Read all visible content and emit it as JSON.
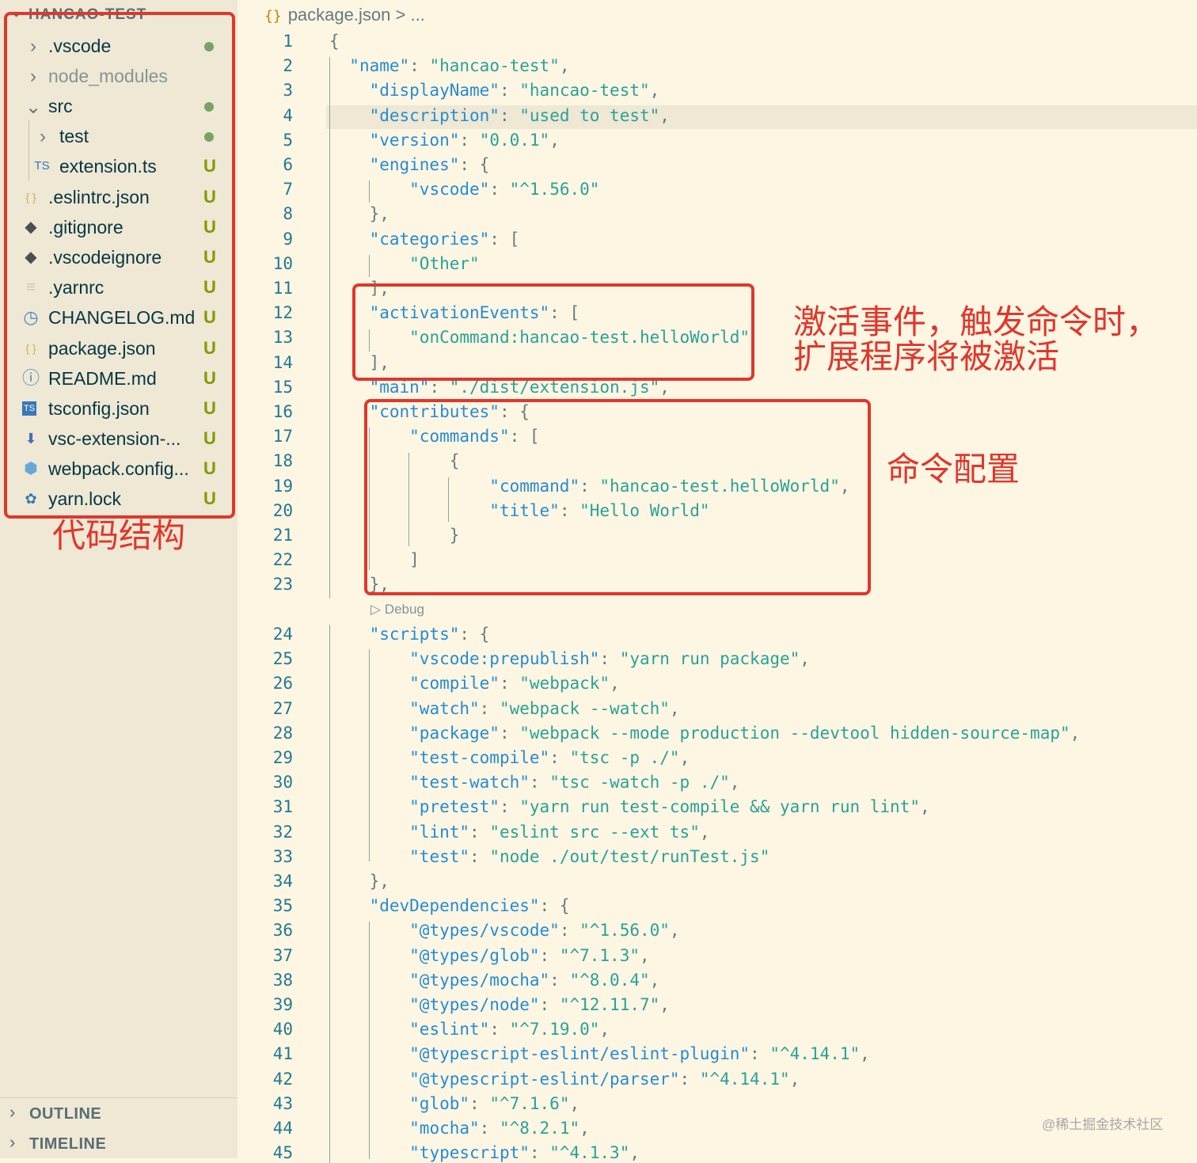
{
  "explorer": {
    "title": "HANCAO-TEST",
    "items": [
      {
        "label": ".vscode",
        "icon": "chevron-right",
        "status": "dot"
      },
      {
        "label": "node_modules",
        "icon": "chevron-right",
        "status": ""
      },
      {
        "label": "src",
        "icon": "chevron-down",
        "status": "dot"
      },
      {
        "label": "test",
        "icon": "chevron-right",
        "status": "dot"
      },
      {
        "label": "extension.ts",
        "icon": "ts-file-icon",
        "icon_text": "TS",
        "status": "U"
      },
      {
        "label": ".eslintrc.json",
        "icon": "json-file-icon",
        "icon_text": "{}",
        "status": "U"
      },
      {
        "label": ".gitignore",
        "icon": "git-file-icon",
        "status": "U"
      },
      {
        "label": ".vscodeignore",
        "icon": "git-file-icon",
        "status": "U"
      },
      {
        "label": ".yarnrc",
        "icon": "text-file-icon",
        "status": "U"
      },
      {
        "label": "CHANGELOG.md",
        "icon": "clock-file-icon",
        "status": "U"
      },
      {
        "label": "package.json",
        "icon": "json-file-icon",
        "icon_text": "{}",
        "status": "U"
      },
      {
        "label": "README.md",
        "icon": "info-file-icon",
        "status": "U"
      },
      {
        "label": "tsconfig.json",
        "icon": "tsconfig-file-icon",
        "icon_text": "TS",
        "status": "U"
      },
      {
        "label": "vsc-extension-...",
        "icon": "download-file-icon",
        "status": "U"
      },
      {
        "label": "webpack.config...",
        "icon": "webpack-file-icon",
        "status": "U"
      },
      {
        "label": "yarn.lock",
        "icon": "yarn-file-icon",
        "status": "U"
      }
    ]
  },
  "panels": {
    "outline": "OUTLINE",
    "timeline": "TIMELINE"
  },
  "breadcrumb": {
    "file": "package.json",
    "separator": ">",
    "more": "..."
  },
  "codelens": "Debug",
  "code_lines": [
    "{",
    "  \"name\": \"hancao-test\",",
    "    \"displayName\": \"hancao-test\",",
    "    \"description\": \"used to test\",",
    "    \"version\": \"0.0.1\",",
    "    \"engines\": {",
    "        \"vscode\": \"^1.56.0\"",
    "    },",
    "    \"categories\": [",
    "        \"Other\"",
    "    ],",
    "    \"activationEvents\": [",
    "        \"onCommand:hancao-test.helloWorld\"",
    "    ],",
    "    \"main\": \"./dist/extension.js\",",
    "    \"contributes\": {",
    "        \"commands\": [",
    "            {",
    "                \"command\": \"hancao-test.helloWorld\",",
    "                \"title\": \"Hello World\"",
    "            }",
    "        ]",
    "    },",
    "    \"scripts\": {",
    "        \"vscode:prepublish\": \"yarn run package\",",
    "        \"compile\": \"webpack\",",
    "        \"watch\": \"webpack --watch\",",
    "        \"package\": \"webpack --mode production --devtool hidden-source-map\",",
    "        \"test-compile\": \"tsc -p ./\",",
    "        \"test-watch\": \"tsc -watch -p ./\",",
    "        \"pretest\": \"yarn run test-compile && yarn run lint\",",
    "        \"lint\": \"eslint src --ext ts\",",
    "        \"test\": \"node ./out/test/runTest.js\"",
    "    },",
    "    \"devDependencies\": {",
    "        \"@types/vscode\": \"^1.56.0\",",
    "        \"@types/glob\": \"^7.1.3\",",
    "        \"@types/mocha\": \"^8.0.4\",",
    "        \"@types/node\": \"^12.11.7\",",
    "        \"eslint\": \"^7.19.0\",",
    "        \"@typescript-eslint/eslint-plugin\": \"^4.14.1\",",
    "        \"@typescript-eslint/parser\": \"^4.14.1\",",
    "        \"glob\": \"^7.1.6\",",
    "        \"mocha\": \"^8.2.1\",",
    "        \"typescript\": \"^4.1.3\","
  ],
  "annotations": {
    "code_structure": "代码结构",
    "activation_line1": "激活事件，触发命令时，",
    "activation_line2": "扩展程序将被激活",
    "command_config": "命令配置"
  },
  "watermark": "@稀土掘金技术社区",
  "colors": {
    "accent_red": "#e0372d",
    "key_blue": "#268bd2",
    "string_cyan": "#2aa198",
    "git_untracked": "#859900"
  }
}
